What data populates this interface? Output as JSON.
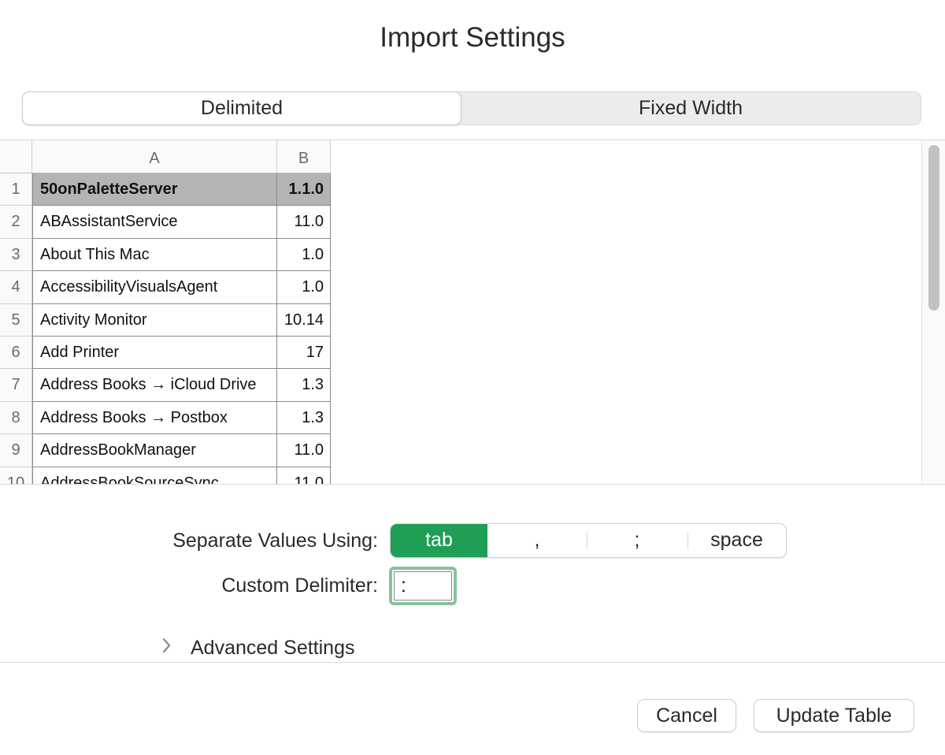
{
  "dialog": {
    "title": "Import Settings"
  },
  "mode_tabs": [
    {
      "label": "Delimited",
      "active": true
    },
    {
      "label": "Fixed Width",
      "active": false
    }
  ],
  "preview": {
    "columns": [
      "A",
      "B"
    ],
    "rows": [
      {
        "num": "1",
        "a": "50onPaletteServer",
        "b": "1.1.0"
      },
      {
        "num": "2",
        "a": "ABAssistantService",
        "b": "11.0"
      },
      {
        "num": "3",
        "a": "About This Mac",
        "b": "1.0"
      },
      {
        "num": "4",
        "a": "AccessibilityVisualsAgent",
        "b": "1.0"
      },
      {
        "num": "5",
        "a": "Activity Monitor",
        "b": "10.14"
      },
      {
        "num": "6",
        "a": "Add Printer",
        "b": "17"
      },
      {
        "num": "7",
        "a": "Address Books → iCloud Drive",
        "b": "1.3"
      },
      {
        "num": "8",
        "a": "Address Books → Postbox",
        "b": "1.3"
      },
      {
        "num": "9",
        "a": "AddressBookManager",
        "b": "11.0"
      },
      {
        "num": "10",
        "a": "AddressBookSourceSync",
        "b": "11.0"
      }
    ]
  },
  "separator": {
    "label": "Separate Values Using:",
    "options": [
      {
        "label": "tab",
        "active": true
      },
      {
        "label": ",",
        "active": false
      },
      {
        "label": ";",
        "active": false
      },
      {
        "label": "space",
        "active": false
      }
    ],
    "accent_color": "#1f9e55"
  },
  "custom_delimiter": {
    "label": "Custom Delimiter:",
    "value": ":"
  },
  "advanced": {
    "label": "Advanced Settings",
    "icon": "chevron-right-icon"
  },
  "buttons": {
    "cancel": "Cancel",
    "update": "Update Table"
  }
}
